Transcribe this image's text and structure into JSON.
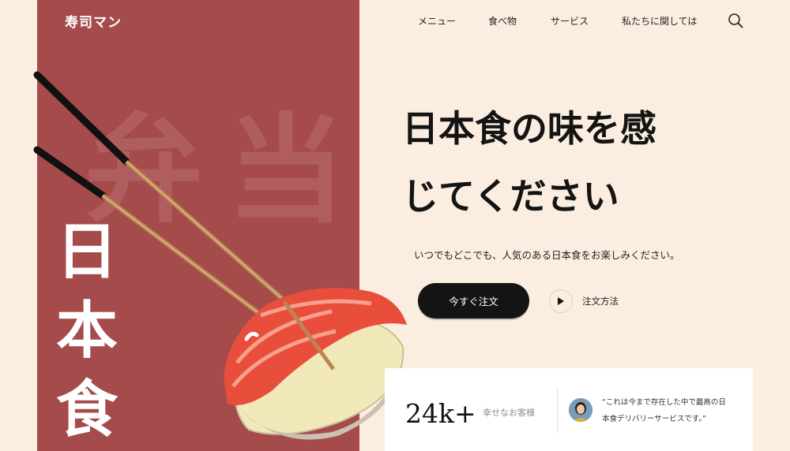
{
  "brand": {
    "name": "寿司マン"
  },
  "nav": {
    "items": [
      "メニュー",
      "食べ物",
      "サービス",
      "私たちに関しては"
    ]
  },
  "background_kanji": "弁当",
  "vertical_title": [
    "日",
    "本",
    "食"
  ],
  "hero": {
    "headline_line1": "日本食の味を感",
    "headline_line2": "じてください",
    "subcopy": "いつでもどこでも、人気のある日本食をお楽しみください。",
    "cta_label": "今すぐ注文",
    "how_to_label": "注文方法"
  },
  "stats": {
    "count": "24k+",
    "count_caption": "幸せなお客様",
    "testimonial": "“これは今まで存在した中で最高の日本食デリバリーサービスです。”"
  },
  "colors": {
    "panel": "#a64b4c",
    "page": "#fbeee0",
    "button": "#141414"
  },
  "icons": {
    "search": "search-icon",
    "play": "play-icon"
  }
}
